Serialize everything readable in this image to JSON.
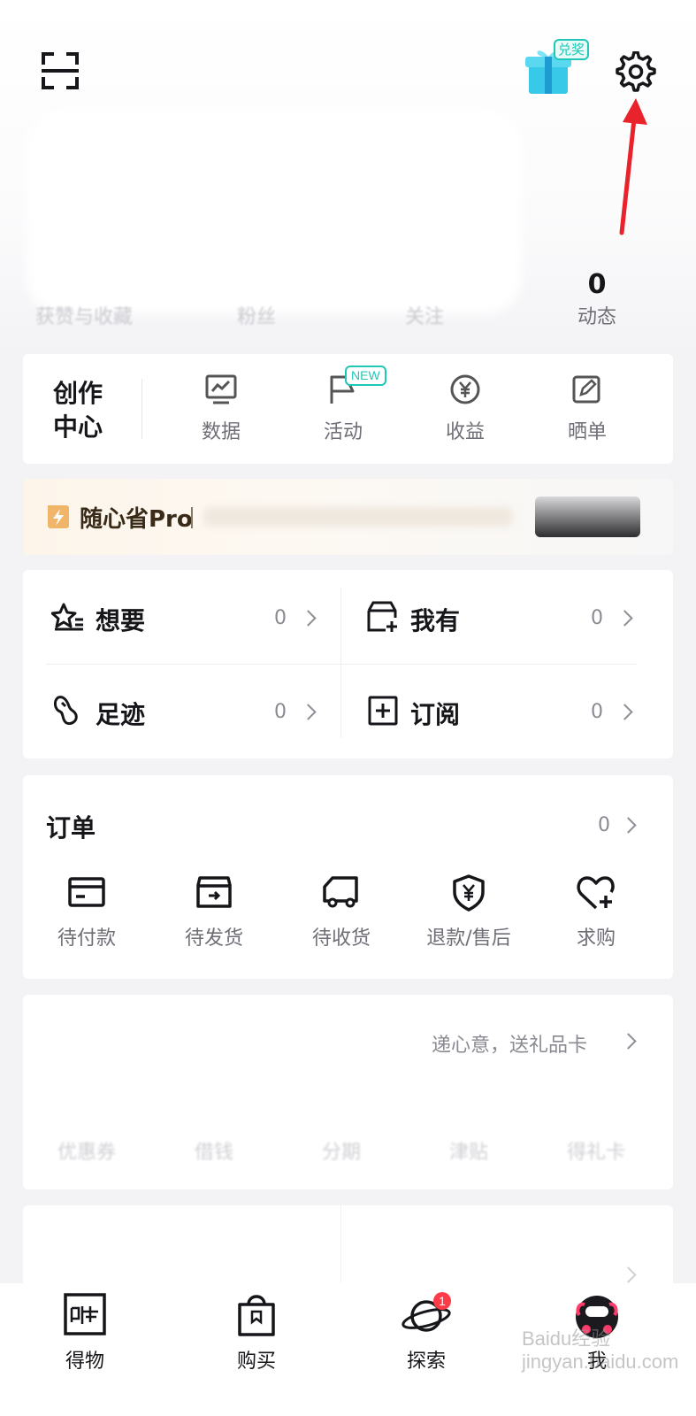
{
  "header": {
    "scan_icon": "scan-icon",
    "gift_badge": "兑奖",
    "settings_icon": "gear-icon"
  },
  "stats": [
    {
      "value": "",
      "label": "获赞与收藏"
    },
    {
      "value": "",
      "label": "粉丝"
    },
    {
      "value": "",
      "label": "关注"
    },
    {
      "value": "0",
      "label": "动态"
    }
  ],
  "creator": {
    "title_line1": "创作",
    "title_line2": "中心",
    "items": [
      {
        "label": "数据",
        "icon": "chart-icon"
      },
      {
        "label": "活动",
        "icon": "flag-icon",
        "badge": "NEW"
      },
      {
        "label": "收益",
        "icon": "yen-icon"
      },
      {
        "label": "晒单",
        "icon": "edit-icon"
      }
    ]
  },
  "promo": {
    "title": "随心省Pro",
    "subtitle": "",
    "button": ""
  },
  "quick": [
    {
      "label": "想要",
      "count": "0",
      "icon": "star-list-icon"
    },
    {
      "label": "我有",
      "count": "0",
      "icon": "box-plus-icon"
    },
    {
      "label": "足迹",
      "count": "0",
      "icon": "footprint-icon"
    },
    {
      "label": "订阅",
      "count": "0",
      "icon": "add-square-icon"
    }
  ],
  "orders": {
    "title": "订单",
    "count": "0",
    "items": [
      {
        "label": "待付款",
        "icon": "card-icon"
      },
      {
        "label": "待发货",
        "icon": "package-icon"
      },
      {
        "label": "待收货",
        "icon": "truck-icon"
      },
      {
        "label": "退款/售后",
        "icon": "shield-yen-icon"
      },
      {
        "label": "求购",
        "icon": "heart-plus-icon"
      }
    ]
  },
  "wallet": {
    "promo_text": "递心意，送礼品卡",
    "items": [
      {
        "value": "",
        "label": "优惠券"
      },
      {
        "value": "",
        "label": "借钱"
      },
      {
        "value": "",
        "label": "分期"
      },
      {
        "value": "",
        "label": "津贴"
      },
      {
        "value": "",
        "label": "得礼卡"
      }
    ]
  },
  "tabbar": [
    {
      "label": "得物",
      "icon": "dewu-logo-icon"
    },
    {
      "label": "购买",
      "icon": "shopping-bag-icon"
    },
    {
      "label": "探索",
      "icon": "planet-icon"
    },
    {
      "label": "我",
      "icon": "avatar-icon"
    }
  ],
  "watermark": "Baidu经验 jingyan.baidu.com",
  "colors": {
    "accent": "#1fc7b7",
    "arrow": "#e8232b",
    "promo_gold": "#e89a3a"
  }
}
